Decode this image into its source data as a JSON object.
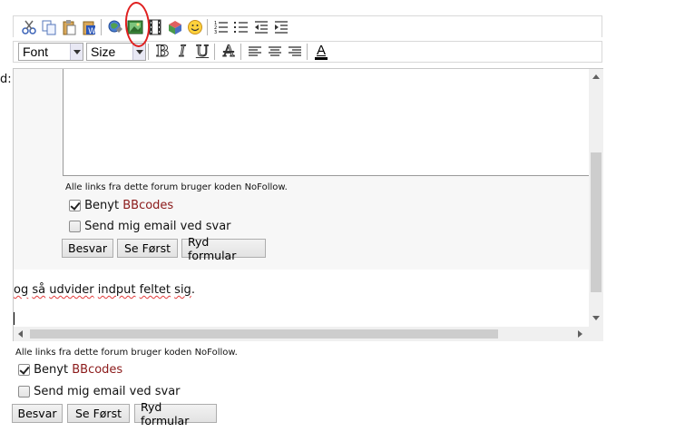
{
  "left_label_fragment": "d:",
  "toolbar1": {
    "icons": [
      "cut-icon",
      "copy-icon",
      "paste-icon",
      "paste-word-icon",
      "link-icon",
      "insert-image-icon",
      "insert-movie-icon",
      "insert-flash-icon",
      "smiley-icon",
      "ordered-list-icon",
      "unordered-list-icon",
      "outdent-icon",
      "indent-icon"
    ]
  },
  "toolbar2": {
    "font_select": "Font",
    "size_select": "Size",
    "bold": "B",
    "italic": "I",
    "underline": "U",
    "strike": "A",
    "font_color": "A"
  },
  "inner_form": {
    "nofollow_notice": "Alle links fra dette forum bruger koden NoFollow.",
    "use_prefix": "Benyt ",
    "bbcodes_link": "BBcodes",
    "email_label": "Send mig email ved svar",
    "buttons": {
      "reply": "Besvar",
      "preview": "Se Først",
      "reset": "Ryd formular"
    }
  },
  "editor_text": {
    "w1": "og",
    "w2": "så",
    "w3": "udvider",
    "w4": "indput",
    "w5": "feltet",
    "w6": "sig",
    "end": "."
  },
  "outer_form": {
    "nofollow_notice": "Alle links fra dette forum bruger koden NoFollow.",
    "use_prefix": "Benyt ",
    "bbcodes_link": "BBcodes",
    "email_label": "Send mig email ved svar",
    "buttons": {
      "reply": "Besvar",
      "preview": "Se Først",
      "reset": "Ryd formular"
    }
  },
  "checkboxes": {
    "use_bbcodes_checked": true,
    "send_email_checked": false
  },
  "colors": {
    "annotation": "#e02020",
    "bbcodes_link": "#8b1a1a",
    "spellcheck": "#e23b3b"
  }
}
